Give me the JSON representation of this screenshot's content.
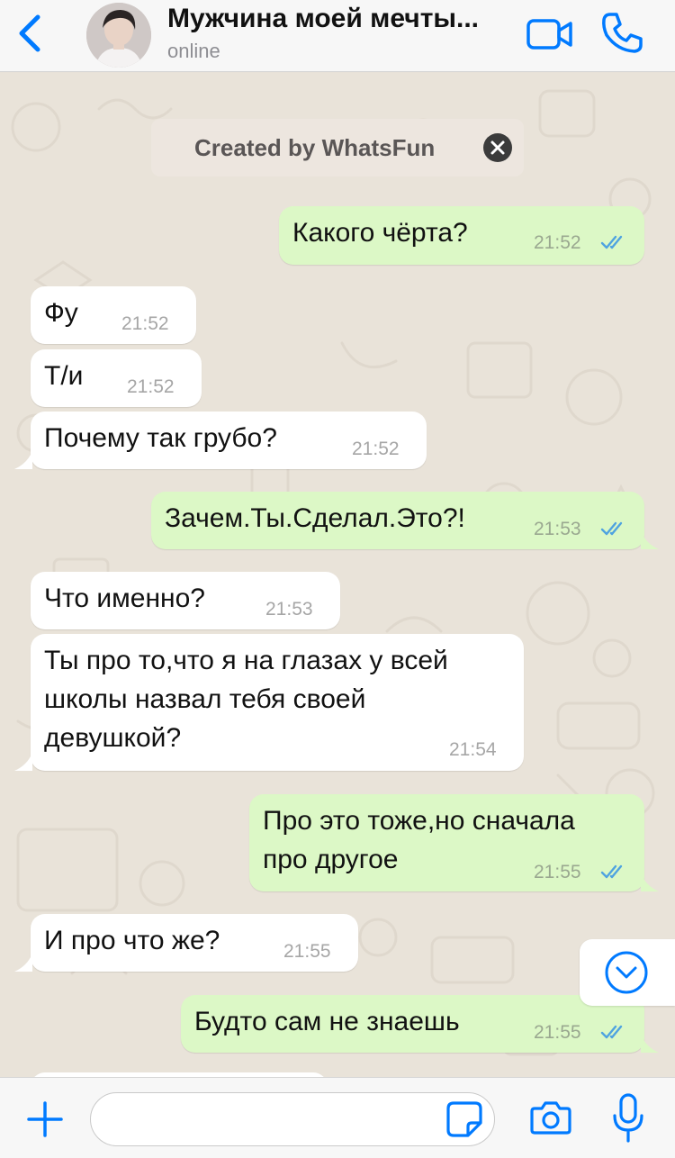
{
  "header": {
    "title": "Мужчина моей мечты...",
    "status": "online",
    "icons": {
      "back": "chevron-left-icon",
      "video": "video-camera-icon",
      "call": "phone-icon"
    }
  },
  "notice": {
    "text": "Created by WhatsFun",
    "close_icon": "close-circle-icon"
  },
  "messages": [
    {
      "direction": "out",
      "lines": [
        "Какого чёрта?"
      ],
      "time": "21:52",
      "status": "read"
    },
    {
      "direction": "in",
      "lines": [
        "Фу"
      ],
      "time": "21:52"
    },
    {
      "direction": "in",
      "lines": [
        "Т/и"
      ],
      "time": "21:52"
    },
    {
      "direction": "in",
      "lines": [
        "Почему так грубо?"
      ],
      "time": "21:52"
    },
    {
      "direction": "out",
      "lines": [
        "Зачем.Ты.Сделал.Это?!"
      ],
      "time": "21:53",
      "status": "read"
    },
    {
      "direction": "in",
      "lines": [
        "Что именно?"
      ],
      "time": "21:53"
    },
    {
      "direction": "in",
      "lines": [
        "Ты про то,что я на глазах у всей",
        "школы назвал тебя своей",
        "девушкой?"
      ],
      "time": "21:54"
    },
    {
      "direction": "out",
      "lines": [
        "Про это тоже,но сначала",
        "про другое"
      ],
      "time": "21:55",
      "status": "read"
    },
    {
      "direction": "in",
      "lines": [
        "И про что же?"
      ],
      "time": "21:55"
    },
    {
      "direction": "out",
      "lines": [
        "Будто сам не знаешь"
      ],
      "time": "21:55",
      "status": "read"
    }
  ],
  "input": {
    "placeholder": "",
    "value": ""
  },
  "colors": {
    "accent": "#007aff",
    "outgoing_bubble": "#dcf8c6",
    "incoming_bubble": "#ffffff",
    "read_ticks": "#4fa3e0"
  },
  "toolbar_icons": [
    "plus-icon",
    "sticker-icon",
    "camera-icon",
    "microphone-icon"
  ],
  "scroll_icon": "chevron-down-circle-icon"
}
